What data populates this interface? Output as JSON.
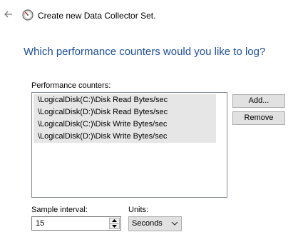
{
  "header": {
    "title": "Create new Data Collector Set."
  },
  "page": {
    "headline": "Which performance counters would you like to log?"
  },
  "counters": {
    "label": "Performance counters:",
    "items": [
      "\\LogicalDisk(C:)\\Disk Read Bytes/sec",
      "\\LogicalDisk(D:)\\Disk Read Bytes/sec",
      "\\LogicalDisk(C:)\\Disk Write Bytes/sec",
      "\\LogicalDisk(D:)\\Disk Write Bytes/sec"
    ]
  },
  "buttons": {
    "add": "Add...",
    "remove": "Remove"
  },
  "sample_interval": {
    "label": "Sample interval:",
    "value": "15"
  },
  "units": {
    "label": "Units:",
    "selected": "Seconds"
  },
  "colors": {
    "headline": "#1e4e9a",
    "selection": "#e6e6e6",
    "app_icon_accent": "#c42b1c"
  },
  "icons": {
    "back": "back-arrow-icon",
    "app": "performance-monitor-icon",
    "spin_up": "spin-up-icon",
    "spin_down": "spin-down-icon",
    "dropdown": "chevron-down-icon"
  }
}
